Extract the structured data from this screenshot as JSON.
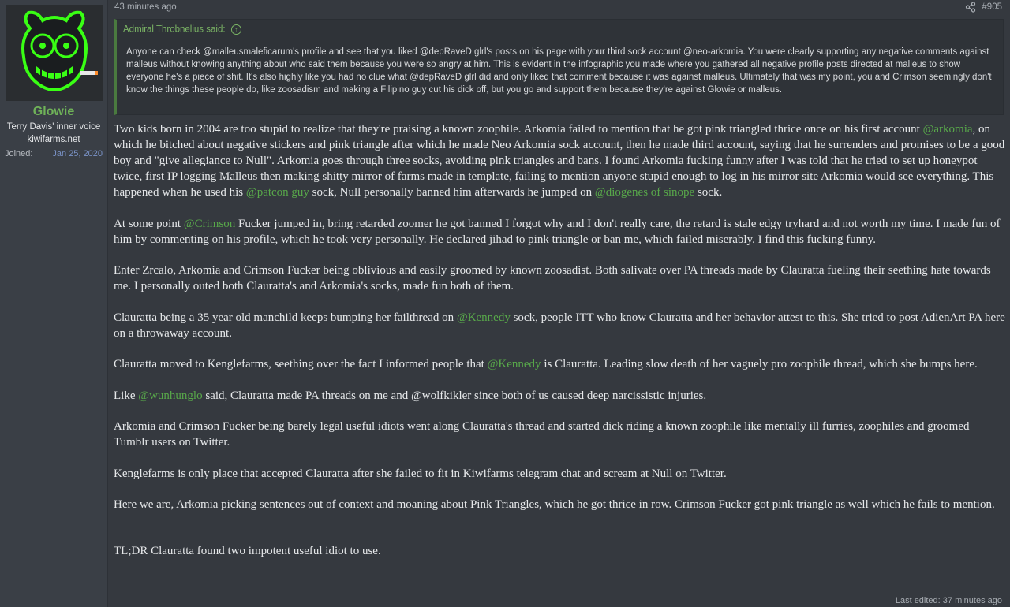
{
  "user": {
    "name": "Glowie",
    "title": "Terry Davis' inner voice",
    "site": "kiwifarms.net",
    "joined_label": "Joined:",
    "joined_date": "Jan 25, 2020"
  },
  "post": {
    "time": "43 minutes ago",
    "number": "#905",
    "last_edited": "Last edited: 37 minutes ago"
  },
  "quote": {
    "header": "Admiral Throbnelius said:",
    "body": "Anyone can check @malleusmaleficarum's profile and see that you liked @depRaveD glrl's posts on his page with your third sock account @neo-arkomia. You were clearly supporting any negative comments against malleus without knowing anything about who said them because you were so angry at him. This is evident in the infographic you made where you gathered all negative profile posts directed at malleus to show everyone he's a piece of shit. It's also highly like you had no clue what @depRaveD glrl did and only liked that comment because it was against malleus. Ultimately that was my point, you and Crimson seemingly don't know the things these people do, like zoosadism and making a Filipino guy cut his dick off, but you go and support them because they're against Glowie or malleus."
  },
  "paragraphs": [
    {
      "parts": [
        {
          "text": "Two kids born in 2004 are too stupid to realize that they're praising a known zoophile. Arkomia failed to mention that he got pink triangled thrice once on his first account "
        },
        {
          "text": "@arkomia",
          "mention": true
        },
        {
          "text": ", on which he bitched about negative stickers and pink triangle after which he made Neo Arkomia sock account, then he made third account, saying that he surrenders and promises to be a good boy and \"give allegiance to Null\". Arkomia goes through three socks, avoiding pink triangles and bans. I found Arkomia fucking funny after I was told that he tried to set up honeypot twice, first IP logging Malleus then making shitty mirror of farms made in template, failing to mention anyone stupid enough to log in his mirror site Arkomia would see everything. This happened when he used his "
        },
        {
          "text": "@patcon guy",
          "mention": true
        },
        {
          "text": " sock, Null personally banned him afterwards he jumped on "
        },
        {
          "text": "@diogenes of sinope",
          "mention": true
        },
        {
          "text": " sock."
        }
      ]
    },
    {
      "parts": [
        {
          "text": "At some point "
        },
        {
          "text": "@Crimson",
          "mention": true
        },
        {
          "text": " Fucker jumped in, bring retarded zoomer he got banned I forgot why and I don't really care, the retard is stale edgy tryhard and not worth my time. I made fun of him by commenting on his profile, which he took very personally. He declared jihad to pink triangle or ban me, which failed miserably. I find this fucking funny."
        }
      ]
    },
    {
      "parts": [
        {
          "text": "Enter Zrcalo, Arkomia and Crimson Fucker being oblivious and easily groomed by known zoosadist. Both salivate over PA threads made by Clauratta fueling their seething hate towards me. I personally outed both Clauratta's and Arkomia's socks, made fun both of them."
        }
      ]
    },
    {
      "parts": [
        {
          "text": "Clauratta being a 35 year old manchild keeps bumping her failthread on "
        },
        {
          "text": "@Kennedy",
          "mention": true
        },
        {
          "text": " sock, people ITT who know Clauratta and her behavior attest to this. She tried to post AdienArt PA here on a throwaway account."
        }
      ]
    },
    {
      "parts": [
        {
          "text": "Clauratta moved to Kenglefarms, seething over the fact I informed people that "
        },
        {
          "text": "@Kennedy",
          "mention": true
        },
        {
          "text": " is Clauratta. Leading slow death of her vaguely pro zoophile thread, which she bumps here."
        }
      ]
    },
    {
      "parts": [
        {
          "text": "Like "
        },
        {
          "text": "@wunhunglo",
          "mention": true
        },
        {
          "text": " said, Clauratta made PA threads on me and @wolfkikler since both of us caused deep narcissistic injuries."
        }
      ]
    },
    {
      "parts": [
        {
          "text": "Arkomia and Crimson Fucker being barely legal useful idiots went along Clauratta's thread and started dick riding a known zoophile like mentally ill furries, zoophiles and groomed Tumblr users on Twitter."
        }
      ]
    },
    {
      "parts": [
        {
          "text": "Kenglefarms is only place that accepted Clauratta after she failed to fit in Kiwifarms telegram chat and scream at Null on Twitter."
        }
      ]
    },
    {
      "parts": [
        {
          "text": "Here we are, Arkomia picking sentences out of context and moaning about Pink Triangles, which he got thrice in row. Crimson Fucker got pink triangle as well which he fails to mention."
        }
      ]
    },
    {
      "spacer": true,
      "parts": []
    },
    {
      "parts": [
        {
          "text": "TL;DR Clauratta found two impotent useful idiot to use."
        }
      ]
    }
  ],
  "colors": {
    "accent": "#6fb358",
    "mention": "#58a84a",
    "background": "#35393f"
  },
  "icons": {
    "share": "share-icon",
    "quote_link": "arrow-up-circle-icon"
  }
}
